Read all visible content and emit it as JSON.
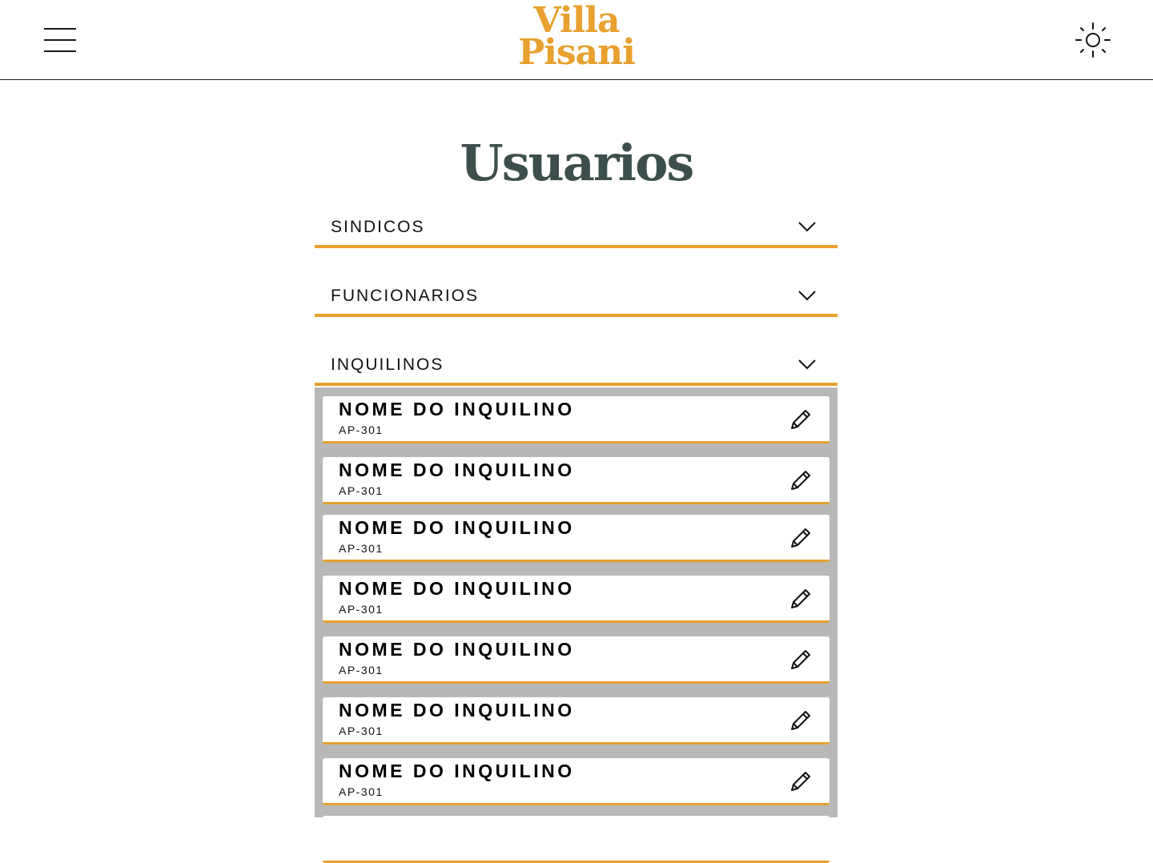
{
  "header": {
    "brand_line1": "Villa",
    "brand_line2": "Pisani",
    "menu_icon": "hamburger-menu-icon",
    "theme_icon": "sun-icon"
  },
  "page": {
    "title": "Usuarios"
  },
  "sections": [
    {
      "label": "SINDICOS",
      "expanded": false
    },
    {
      "label": "FUNCIONARIOS",
      "expanded": false
    },
    {
      "label": "INQUILINOS",
      "expanded": true
    }
  ],
  "tenants": [
    {
      "name": "NOME DO INQUILINO",
      "unit": "AP-301"
    },
    {
      "name": "NOME DO INQUILINO",
      "unit": "AP-301"
    },
    {
      "name": "NOME DO INQUILINO",
      "unit": "AP-301"
    },
    {
      "name": "NOME DO INQUILINO",
      "unit": "AP-301"
    },
    {
      "name": "NOME DO INQUILINO",
      "unit": "AP-301"
    },
    {
      "name": "NOME DO INQUILINO",
      "unit": "AP-301"
    },
    {
      "name": "NOME DO INQUILINO",
      "unit": "AP-301"
    }
  ],
  "colors": {
    "accent": "#e8a02e",
    "title": "#3d4f4c",
    "list_background": "#b8b8b8"
  }
}
